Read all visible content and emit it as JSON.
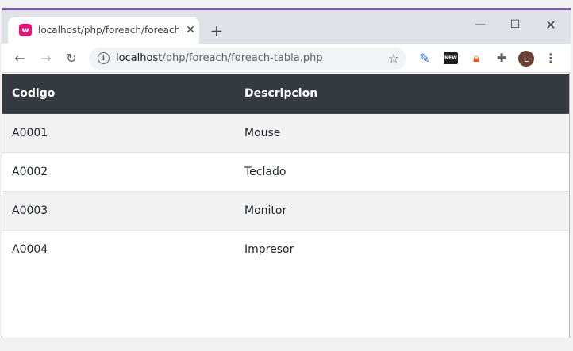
{
  "browser": {
    "tab": {
      "title": "localhost/php/foreach/foreach-tabla.php",
      "favicon_letter": "w",
      "favicon_color": "#e3137a"
    },
    "new_tab_label": "+",
    "window_controls": {
      "minimize": "—",
      "maximize": "☐",
      "close": "✕"
    },
    "url": {
      "host": "localhost",
      "path": "/php/foreach/foreach-tabla.php"
    },
    "extensions": {
      "news_label": "NEW",
      "avatar_letter": "L"
    },
    "accent_color": "#7b5aa6"
  },
  "table": {
    "headers": [
      "Codigo",
      "Descripcion"
    ],
    "header_bg": "#343a40",
    "rows": [
      {
        "codigo": "A0001",
        "descripcion": "Mouse"
      },
      {
        "codigo": "A0002",
        "descripcion": "Teclado"
      },
      {
        "codigo": "A0003",
        "descripcion": "Monitor"
      },
      {
        "codigo": "A0004",
        "descripcion": "Impresor"
      }
    ]
  }
}
